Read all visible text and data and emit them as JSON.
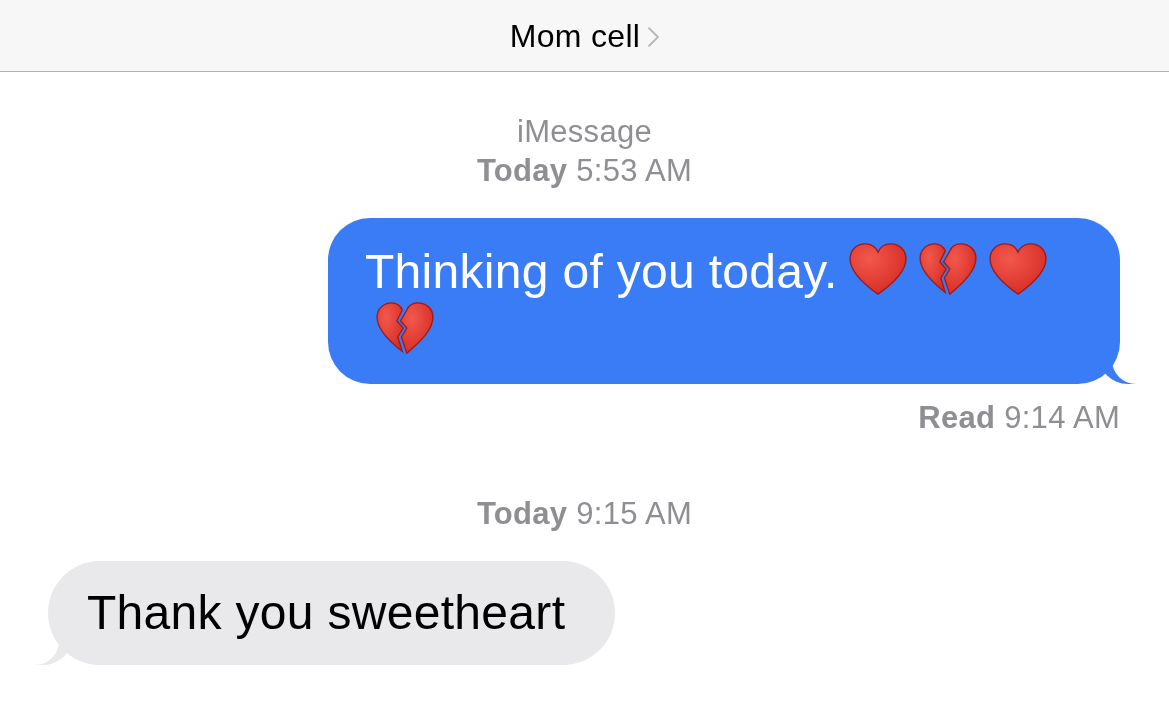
{
  "header": {
    "title": "Mom cell"
  },
  "messages": [
    {
      "kind": "timestamp",
      "service": "iMessage",
      "time": "**Today** 5:53 AM"
    },
    {
      "kind": "outgoing",
      "text": "Thinking of you today.",
      "emoji": [
        {
          "kind": "heart"
        },
        {
          "kind": "broken_heart"
        },
        {
          "kind": "heart"
        },
        {
          "kind": "broken_heart"
        }
      ],
      "receipt": "**Read** 9:14 AM"
    },
    {
      "kind": "timestamp",
      "time": "**Today** 9:15 AM"
    },
    {
      "kind": "incoming",
      "text": "Thank you sweetheart"
    }
  ]
}
